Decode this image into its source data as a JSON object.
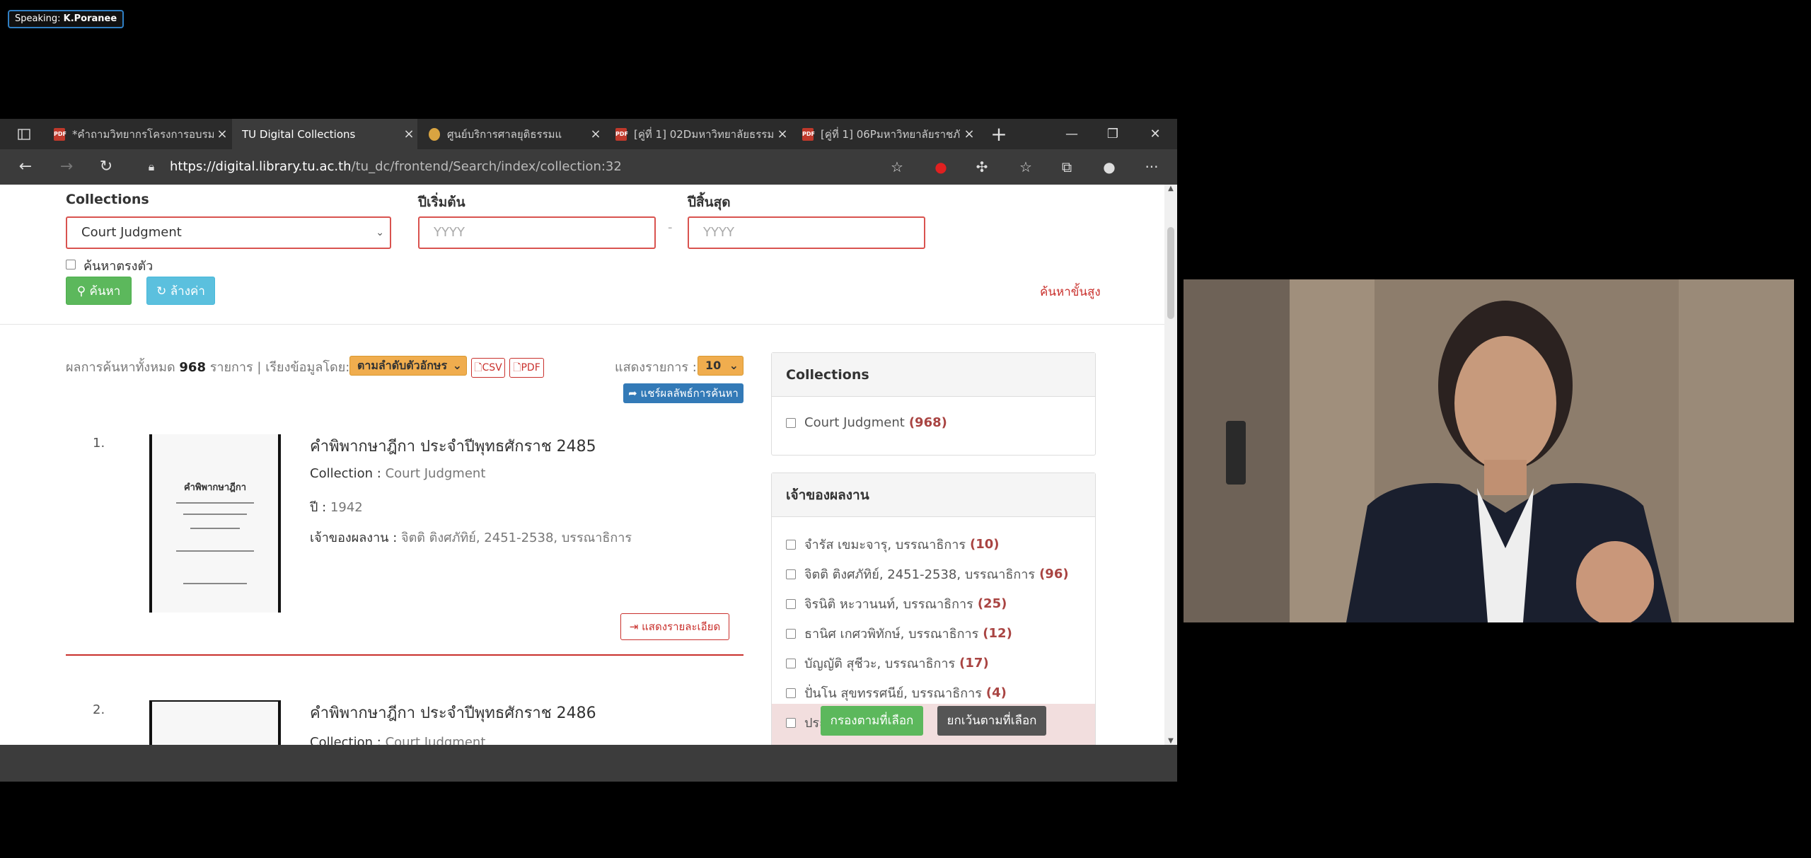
{
  "speaking": {
    "label": "Speaking:",
    "name": "K.Poranee"
  },
  "tabs": [
    {
      "title": "*คำถามวิทยากรโครงการอบรม",
      "icon": "pdf"
    },
    {
      "title": "TU Digital Collections",
      "icon": "page"
    },
    {
      "title": "ศูนย์บริการศาลยุติธรรมแ",
      "icon": "emblem"
    },
    {
      "title": "[คู่ที่ 1] 02Dมหาวิทยาลัยธรรมศ",
      "icon": "pdf"
    },
    {
      "title": "[คู่ที่ 1] 06Pมหาวิทยาลัยราชภั",
      "icon": "pdf"
    }
  ],
  "address": {
    "host": "https://digital.library.tu.ac.th",
    "path": "/tu_dc/frontend/Search/index/collection:32"
  },
  "search": {
    "collections_label": "Collections",
    "collection_value": "Court Judgment",
    "year_start_label": "ปีเริ่มต้น",
    "year_start_placeholder": "YYYY",
    "year_end_label": "ปีสิ้นสุด",
    "year_end_placeholder": "YYYY",
    "dash": "-",
    "exact_label": "ค้นหาตรงตัว",
    "search_btn": "ค้นหา",
    "reset_btn": "ล้างค่า",
    "advanced_link": "ค้นหาขั้นสูง"
  },
  "results": {
    "summary_prefix": "ผลการค้นหาทั้งหมด",
    "total": "968",
    "summary_suffix": "รายการ | เรียงข้อมูลโดย:",
    "sort_value": "ตามลำดับตัวอักษร",
    "csv": "CSV",
    "pdf": "PDF",
    "show_label": "แสดงรายการ :",
    "show_value": "10",
    "share_btn": "แชร์ผลลัพธ์การค้นหา",
    "items": [
      {
        "num": "1.",
        "title": "คำพิพากษาฎีกา ประจำปีพุทธศักราช 2485",
        "collection_label": "Collection :",
        "collection": "Court Judgment",
        "year_label": "ปี :",
        "year": "1942",
        "owner_label": "เจ้าของผลงาน :",
        "owner": "จิตติ ติงศภัทิย์, 2451-2538, บรรณาธิการ",
        "detail_btn": "แสดงรายละเอียด"
      },
      {
        "num": "2.",
        "title": "คำพิพากษาฎีกา ประจำปีพุทธศักราช 2486",
        "collection_label": "Collection :",
        "collection": "Court Judgment"
      }
    ]
  },
  "facets": {
    "collections": {
      "title": "Collections",
      "items": [
        {
          "label": "Court Judgment",
          "count": "(968)"
        }
      ]
    },
    "owners": {
      "title": "เจ้าของผลงาน",
      "items": [
        {
          "label": "จำรัส เขมะจารุ, บรรณาธิการ",
          "count": "(10)"
        },
        {
          "label": "จิตติ ติงศภัทิย์, 2451-2538, บรรณาธิการ",
          "count": "(96)"
        },
        {
          "label": "จิรนิติ หะวานนท์, บรรณาธิการ",
          "count": "(25)"
        },
        {
          "label": "ธานิศ เกศวพิทักษ์, บรรณาธิการ",
          "count": "(12)"
        },
        {
          "label": "บัญญัติ สุชีวะ, บรรณาธิการ",
          "count": "(17)"
        },
        {
          "label": "ปั่นโน สุขทรรศนีย์, บรรณาธิการ",
          "count": "(4)"
        },
        {
          "label": "ประ",
          "count": ""
        }
      ]
    },
    "filter_btn": "กรองตามที่เลือก",
    "exclude_btn": "ยกเว้นตามที่เลือก"
  }
}
